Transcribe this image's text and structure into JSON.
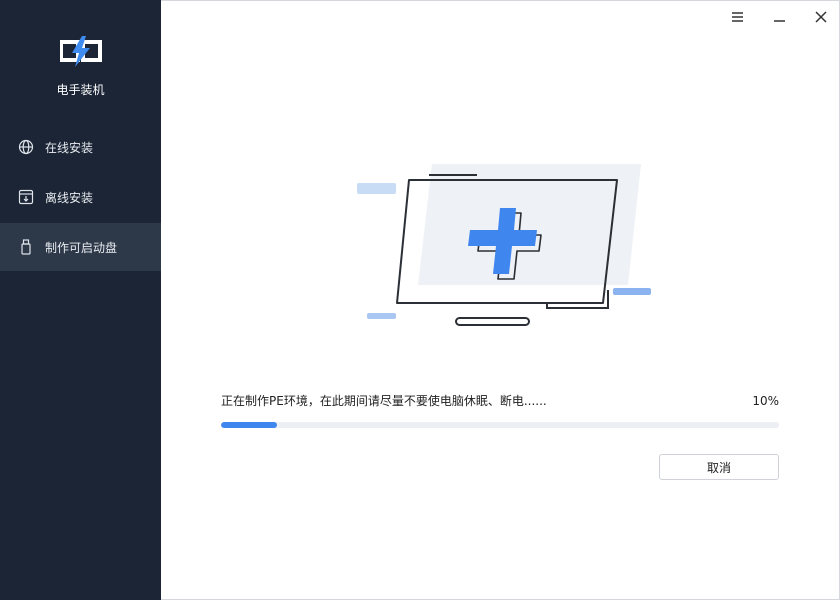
{
  "app": {
    "name": "电手装机"
  },
  "sidebar": {
    "items": [
      {
        "label": "在线安装",
        "icon": "globe-icon"
      },
      {
        "label": "离线安装",
        "icon": "download-box-icon"
      },
      {
        "label": "制作可启动盘",
        "icon": "usb-drive-icon",
        "active": true
      }
    ]
  },
  "window_controls": [
    "menu-icon",
    "minimize-icon",
    "close-icon"
  ],
  "main": {
    "illustration_icon": "monitor-plus-icon",
    "status_text": "正在制作PE环境，在此期间请尽量不要使电脑休眠、断电......",
    "progress": {
      "label": "10%",
      "value": 0.1
    },
    "cancel_label": "取消"
  },
  "colors": {
    "sidebar_bg": "#1b2535",
    "sidebar_active": "#2d3849",
    "accent": "#3f86ee"
  }
}
